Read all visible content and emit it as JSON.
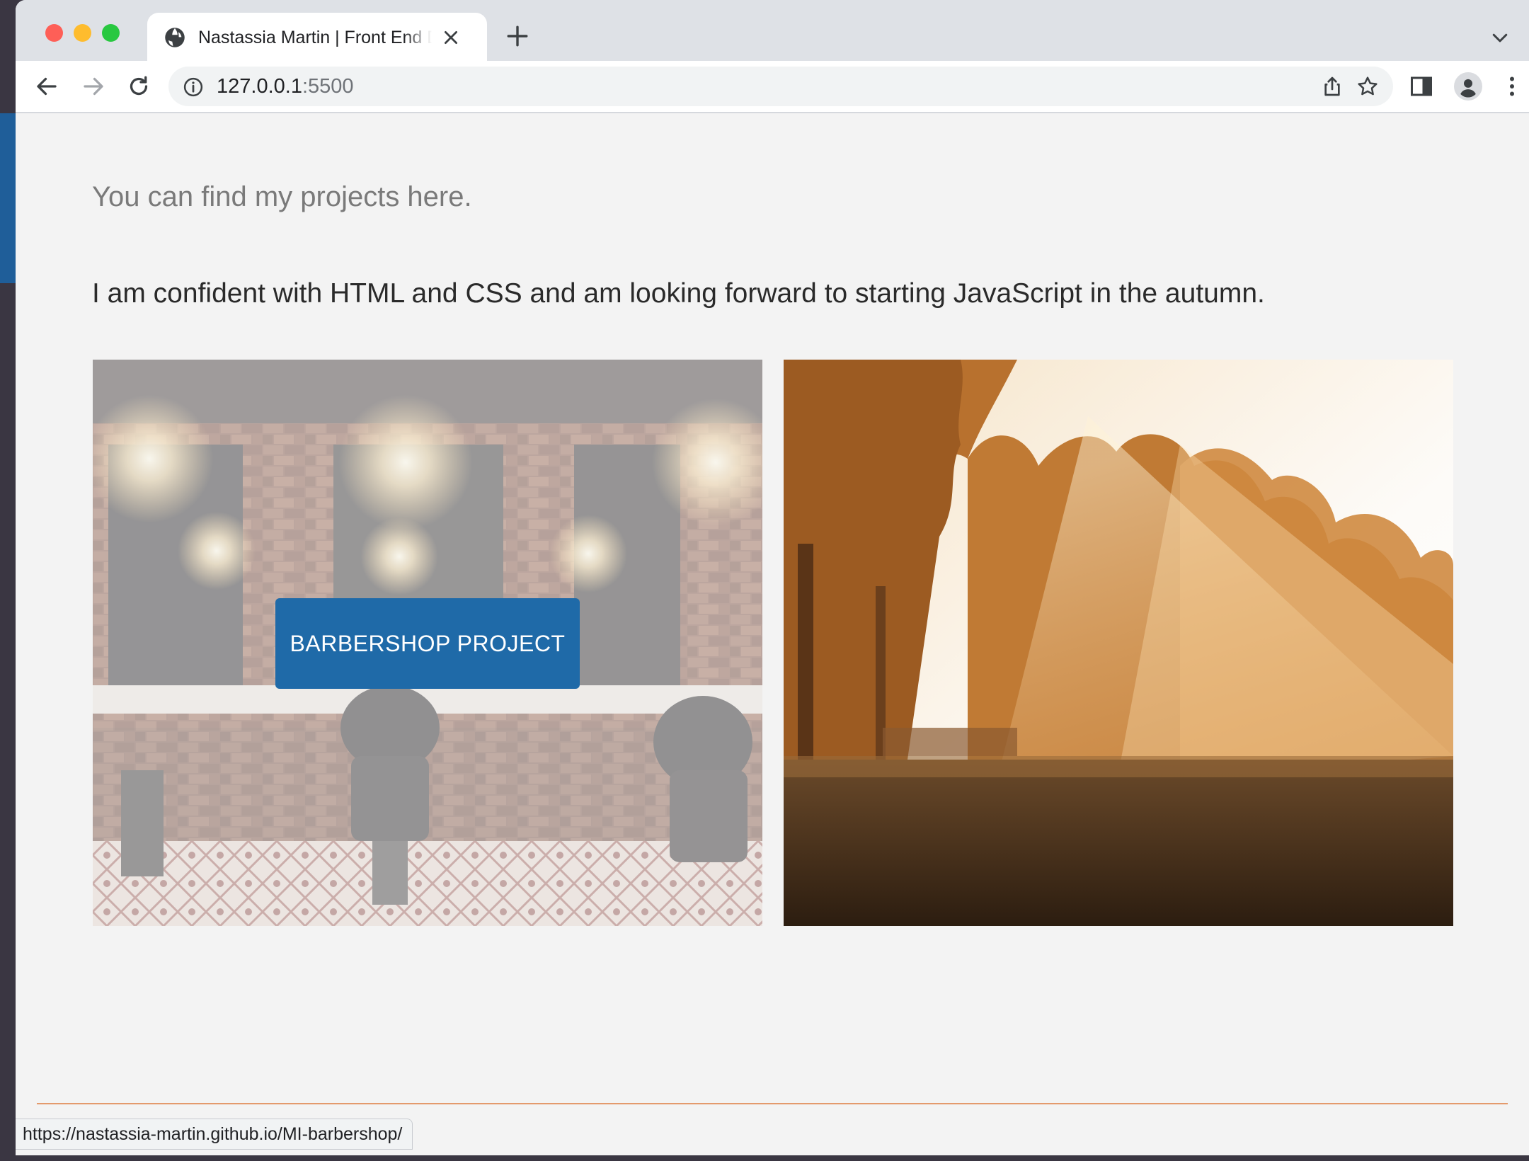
{
  "browser": {
    "tab": {
      "title": "Nastassia Martin | Front End Developer"
    },
    "address": {
      "host": "127.0.0.1",
      "port": ":5500"
    },
    "status_url": "https://nastassia-martin.github.io/MI-barbershop/"
  },
  "page": {
    "intro": "You can find my projects here.",
    "statement": "I am confident with HTML and CSS and am looking forward to starting JavaScript in the autumn.",
    "projects": [
      {
        "button_label": "BARBERSHOP PROJECT",
        "image": "barbershop-interior-photo"
      },
      {
        "image": "misty-forest-sunrise-photo"
      }
    ]
  },
  "colors": {
    "accent_blue": "#1f6aa8",
    "footer_rule": "#e49a6c",
    "page_background": "#f3f3f3"
  }
}
